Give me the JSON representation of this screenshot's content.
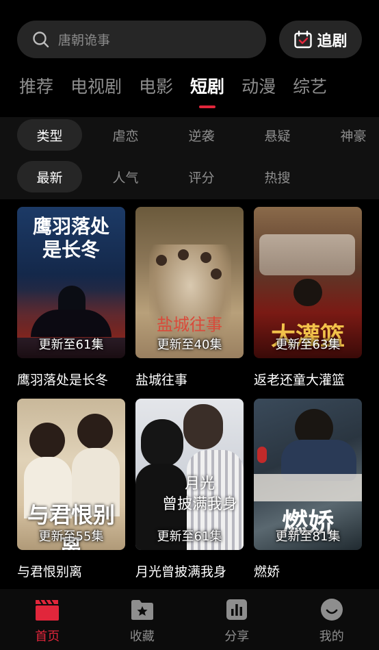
{
  "search": {
    "placeholder": "唐朝诡事"
  },
  "follow_button": {
    "label": "追剧"
  },
  "tabs": [
    {
      "label": "推荐"
    },
    {
      "label": "电视剧"
    },
    {
      "label": "电影"
    },
    {
      "label": "短剧"
    },
    {
      "label": "动漫"
    },
    {
      "label": "综艺"
    }
  ],
  "active_tab": "短剧",
  "filters": {
    "type": [
      "类型",
      "虐恋",
      "逆袭",
      "悬疑",
      "神豪"
    ],
    "sort": [
      "最新",
      "人气",
      "评分",
      "热搜"
    ]
  },
  "shows": [
    {
      "title": "鹰羽落处是长冬",
      "update": "更新至61集",
      "poster_text": "鹰羽落处\n是长冬"
    },
    {
      "title": "盐城往事",
      "update": "更新至40集",
      "poster_text": "盐城往事"
    },
    {
      "title": "返老还童大灌篮",
      "update": "更新至63集",
      "poster_text": "大灌篮"
    },
    {
      "title": "与君恨别离",
      "update": "更新至55集",
      "poster_text": "与君恨别离"
    },
    {
      "title": "月光曾披满我身",
      "update": "更新至61集",
      "poster_text": "月光\n曾披满我身"
    },
    {
      "title": "燃娇",
      "update": "更新至81集",
      "poster_text": "燃娇"
    }
  ],
  "bottom_nav": [
    {
      "label": "首页",
      "icon": "clapperboard-icon"
    },
    {
      "label": "收藏",
      "icon": "folder-star-icon"
    },
    {
      "label": "分享",
      "icon": "bar-chart-icon"
    },
    {
      "label": "我的",
      "icon": "smiley-icon"
    }
  ],
  "colors": {
    "accent": "#e1263b",
    "background": "#000000",
    "surface": "#262626"
  }
}
